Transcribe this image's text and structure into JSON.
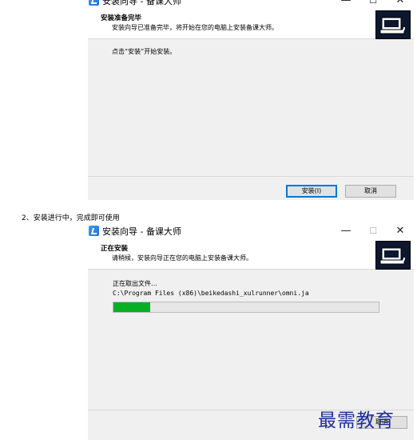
{
  "window1": {
    "title": "安装向导 - 备课大师",
    "header_title": "安装准备完毕",
    "header_subtitle": "安装向导已准备完毕，将开始在您的电脑上安装备课大师。",
    "body_text": "点击“安装”开始安装。",
    "install_button": "安装(I)",
    "cancel_button": "取消"
  },
  "section_heading": "2、安装进行中，完成即可使用",
  "window2": {
    "title": "安装向导 - 备课大师",
    "header_title": "正在安装",
    "header_subtitle": "请稍候，安装向导正在您的电脑上安装备课大师。",
    "status_text": "正在取出文件…",
    "file_path": "C:\\Program Files (x86)\\beikedashi_xulrunner\\omni.ja",
    "progress": 0.14,
    "partial_button": "取消"
  },
  "watermark": "最需教育",
  "colors": {
    "progress": "#06b025",
    "watermark": "#1f2d9a",
    "window_bg": "#f0f0f0"
  },
  "icons": [
    "app-icon",
    "minimize-icon",
    "maximize-icon",
    "close-icon",
    "computer-install-icon"
  ]
}
